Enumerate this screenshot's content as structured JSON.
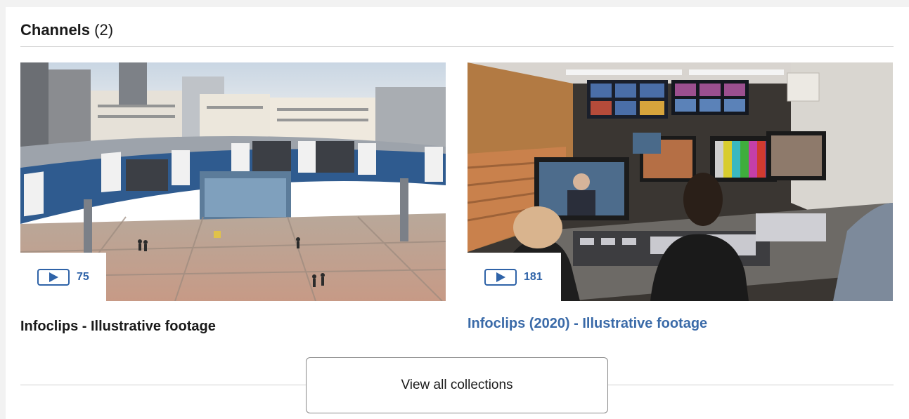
{
  "section": {
    "title": "Channels",
    "count": "(2)"
  },
  "channels": [
    {
      "video_count": "75",
      "title": "Infoclips - Illustrative footage",
      "icon": "play-icon"
    },
    {
      "video_count": "181",
      "title": "Infoclips (2020) - Illustrative footage",
      "icon": "play-icon"
    }
  ],
  "view_all": {
    "label": "View all collections"
  },
  "colors": {
    "accent": "#2f63a8",
    "link_title": "#3a6aa8",
    "rule": "#cfcfcf"
  }
}
